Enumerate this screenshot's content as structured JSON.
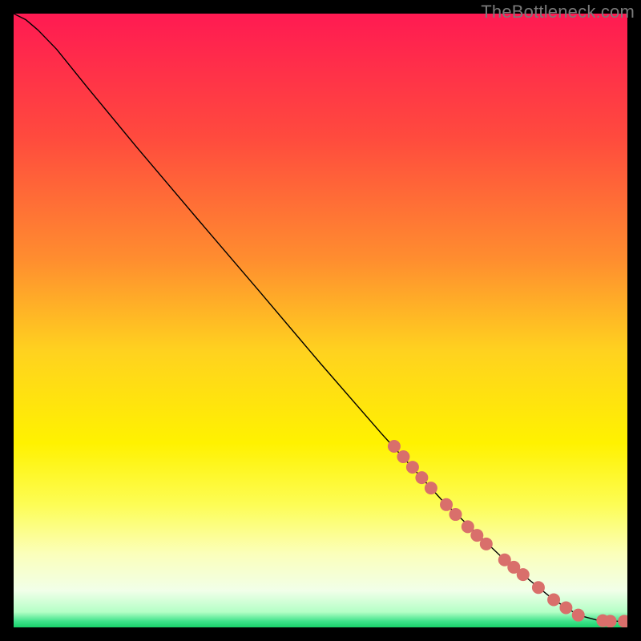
{
  "watermark": "TheBottleneck.com",
  "chart_data": {
    "type": "line",
    "title": "",
    "xlabel": "",
    "ylabel": "",
    "xlim": [
      0,
      100
    ],
    "ylim": [
      0,
      100
    ],
    "grid": false,
    "background_gradient_stops": [
      {
        "offset": 0.0,
        "color": "#ff1a52"
      },
      {
        "offset": 0.2,
        "color": "#ff4a3e"
      },
      {
        "offset": 0.4,
        "color": "#ff8d2f"
      },
      {
        "offset": 0.55,
        "color": "#ffd21f"
      },
      {
        "offset": 0.7,
        "color": "#fff200"
      },
      {
        "offset": 0.8,
        "color": "#fdfd55"
      },
      {
        "offset": 0.88,
        "color": "#fbffba"
      },
      {
        "offset": 0.94,
        "color": "#f1ffe9"
      },
      {
        "offset": 0.975,
        "color": "#b4ffc6"
      },
      {
        "offset": 0.99,
        "color": "#3fe28b"
      },
      {
        "offset": 1.0,
        "color": "#19d06a"
      }
    ],
    "series": [
      {
        "name": "curve",
        "stroke": "#000000",
        "stroke_width": 1.4,
        "points": [
          {
            "x": 0.0,
            "y": 100.0
          },
          {
            "x": 2.0,
            "y": 99.0
          },
          {
            "x": 4.0,
            "y": 97.3
          },
          {
            "x": 7.0,
            "y": 94.2
          },
          {
            "x": 12.0,
            "y": 88.0
          },
          {
            "x": 20.0,
            "y": 78.3
          },
          {
            "x": 30.0,
            "y": 66.5
          },
          {
            "x": 40.0,
            "y": 54.8
          },
          {
            "x": 50.0,
            "y": 43.0
          },
          {
            "x": 60.0,
            "y": 31.5
          },
          {
            "x": 70.0,
            "y": 20.5
          },
          {
            "x": 80.0,
            "y": 11.0
          },
          {
            "x": 88.0,
            "y": 4.5
          },
          {
            "x": 92.0,
            "y": 2.0
          },
          {
            "x": 95.0,
            "y": 1.2
          },
          {
            "x": 97.0,
            "y": 1.0
          },
          {
            "x": 100.0,
            "y": 1.0
          }
        ]
      }
    ],
    "markers": {
      "color": "#d96f6b",
      "radius": 8,
      "points": [
        {
          "x": 62.0,
          "y": 29.5
        },
        {
          "x": 63.5,
          "y": 27.8
        },
        {
          "x": 65.0,
          "y": 26.1
        },
        {
          "x": 66.5,
          "y": 24.4
        },
        {
          "x": 68.0,
          "y": 22.7
        },
        {
          "x": 70.5,
          "y": 20.0
        },
        {
          "x": 72.0,
          "y": 18.4
        },
        {
          "x": 74.0,
          "y": 16.4
        },
        {
          "x": 75.5,
          "y": 15.0
        },
        {
          "x": 77.0,
          "y": 13.6
        },
        {
          "x": 80.0,
          "y": 11.0
        },
        {
          "x": 81.5,
          "y": 9.8
        },
        {
          "x": 83.0,
          "y": 8.6
        },
        {
          "x": 85.5,
          "y": 6.5
        },
        {
          "x": 88.0,
          "y": 4.5
        },
        {
          "x": 90.0,
          "y": 3.2
        },
        {
          "x": 92.0,
          "y": 2.0
        },
        {
          "x": 96.0,
          "y": 1.1
        },
        {
          "x": 97.2,
          "y": 1.0
        },
        {
          "x": 99.5,
          "y": 1.0
        }
      ]
    }
  }
}
